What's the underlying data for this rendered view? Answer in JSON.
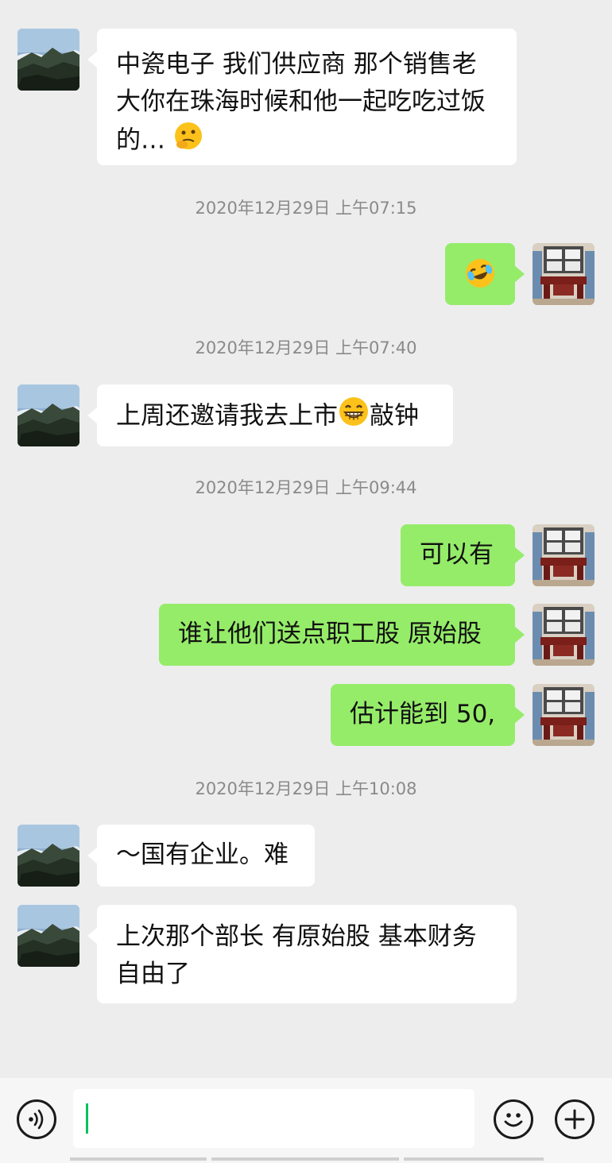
{
  "messages": [
    {
      "side": "in",
      "text": "中瓷电子 我们供应商 那个销售老大你在珠海时候和他一起吃吃过饭的…"
    },
    {
      "side": "out",
      "emoji": "laughing-crying-emoji"
    },
    {
      "side": "in",
      "text_a": "上周还邀请我去上市",
      "text_b": "敲钟"
    },
    {
      "side": "out",
      "text": "可以有"
    },
    {
      "side": "out",
      "text": "谁让他们送点职工股 原始股"
    },
    {
      "side": "out",
      "text": "估计能到 50,"
    },
    {
      "side": "in",
      "text": "～国有企业。难"
    },
    {
      "side": "in",
      "text": "上次那个部长 有原始股 基本财务自由了"
    }
  ],
  "timestamps": [
    "2020年12月29日 上午07:15",
    "2020年12月29日 上午07:40",
    "2020年12月29日 上午09:44",
    "2020年12月29日 上午10:08"
  ],
  "input_bar": {
    "value": "",
    "voice_icon": "voice-icon",
    "emoji_icon": "emoji-icon",
    "plus_icon": "plus-icon"
  },
  "colors": {
    "incoming": "#ffffff",
    "outgoing": "#95ec69",
    "background": "#ededed",
    "caret": "#07c160"
  }
}
